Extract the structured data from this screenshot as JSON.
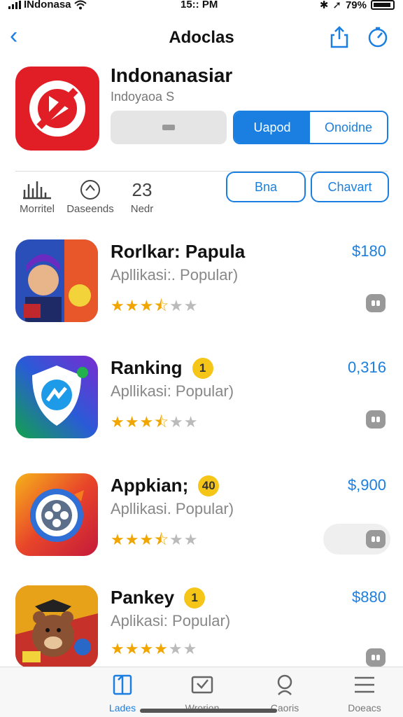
{
  "status_bar": {
    "carrier": "INdonasa",
    "time": "15:: PM",
    "battery": "79%"
  },
  "nav": {
    "title": "Adoclas"
  },
  "app": {
    "name": "Indonanasiar",
    "developer": "Indoyaoa S",
    "primary_label": "Uapod",
    "secondary_label": "Onoidne"
  },
  "stats": [
    {
      "label": "Morritel",
      "value": ""
    },
    {
      "label": "Daseends",
      "value": ""
    },
    {
      "label": "Nedr",
      "value": "23"
    }
  ],
  "pills": [
    "Bna",
    "Chavart"
  ],
  "items": [
    {
      "name": "Rorlkar: Papula",
      "badge": "",
      "subtitle": "Apllikasi:. Popular)",
      "rating": 3.5,
      "price": "$180"
    },
    {
      "name": "Ranking",
      "badge": "1",
      "subtitle": "Apllikasi: Popular)",
      "rating": 3.5,
      "price": "0,316"
    },
    {
      "name": "Appkian;",
      "badge": "40",
      "subtitle": "Apllikasi. Popular)",
      "rating": 3.5,
      "price": "$,900"
    },
    {
      "name": "Pankey",
      "badge": "1",
      "subtitle": "Aplikasi: Popular)",
      "rating": 4,
      "price": "$880"
    }
  ],
  "tabs": [
    {
      "label": "Lades",
      "icon": "book-icon",
      "active": true
    },
    {
      "label": "Wrorion",
      "icon": "check-frame-icon",
      "active": false
    },
    {
      "label": "Caoris",
      "icon": "search-icon",
      "active": false
    },
    {
      "label": "Doeacs",
      "icon": "menu-icon",
      "active": false
    }
  ],
  "colors": {
    "accent": "#1a7fe0",
    "star": "#f0a500",
    "badge": "#f5c518",
    "app_icon": "#e11d25"
  }
}
